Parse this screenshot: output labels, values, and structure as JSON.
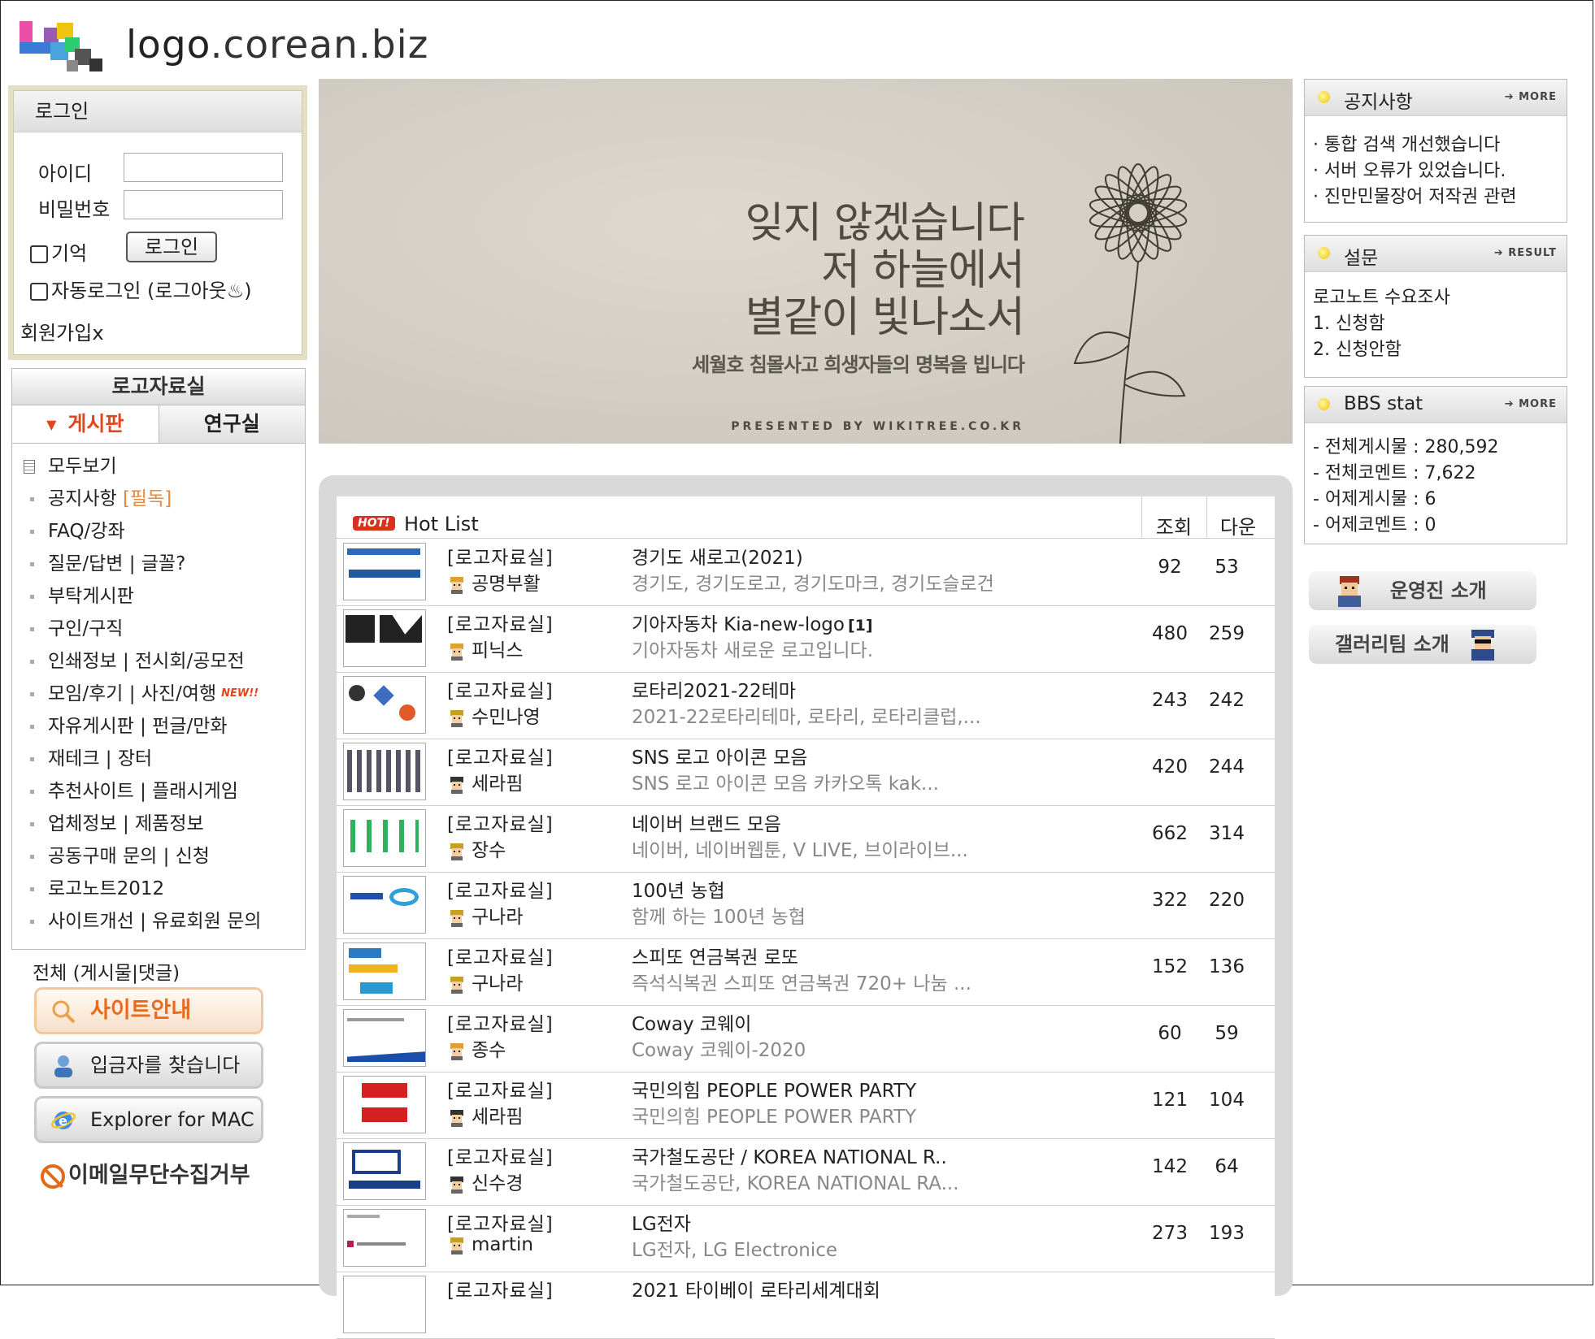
{
  "header": {
    "logo_prefix": "logo",
    "logo_suffix": ".corean.biz"
  },
  "login": {
    "title": "로그인",
    "id_label": "아이디",
    "pw_label": "비밀번호",
    "id_value": "",
    "pw_value": "",
    "remember_label": "기억",
    "button_label": "로그인",
    "auto_login_label": "자동로그인 (로그아웃♨)",
    "signup_label": "회원가입x"
  },
  "board": {
    "title": "로고자료실",
    "tabs": [
      {
        "label": "게시판"
      },
      {
        "label": "연구실"
      }
    ],
    "items": [
      {
        "label": "모두보기"
      },
      {
        "label": "공지사항",
        "tag": "[필독]"
      },
      {
        "label": "FAQ/강좌"
      },
      {
        "label": "질문/답변 | 글꼴?"
      },
      {
        "label": "부탁게시판"
      },
      {
        "label": "구인/구직"
      },
      {
        "label": "인쇄정보 | 전시회/공모전"
      },
      {
        "label": "모임/후기 | 사진/여행",
        "badge": "NEW!!"
      },
      {
        "label": "자유게시판 | 펀글/만화"
      },
      {
        "label": "재테크 | 장터"
      },
      {
        "label": "추천사이트 | 플래시게임"
      },
      {
        "label": "업체정보 | 제품정보"
      },
      {
        "label": "공동구매 문의 | 신청"
      },
      {
        "label": "로고노트2012"
      },
      {
        "label": "사이트개선 | 유료회원 문의"
      }
    ]
  },
  "sidebar_extra": {
    "total_label": "전체 (게시물|댓글)",
    "buttons": [
      {
        "label": "사이트안내",
        "icon": "magnifier-icon"
      },
      {
        "label": "입금자를 찾습니다",
        "icon": "person-icon"
      },
      {
        "label": "Explorer for MAC",
        "icon": "explorer-icon"
      }
    ],
    "no_email_label": "이메일무단수집거부"
  },
  "banner": {
    "line1": "잊지 않겠습니다",
    "line2": "저 하늘에서",
    "line3": "별같이 빛나소서",
    "sub": "세월호 침몰사고 희생자들의 명복을 빕니다",
    "credit": "PRESENTED BY WIKITREE.CO.KR"
  },
  "hot_list": {
    "badge": "HOT!",
    "title": "Hot List",
    "col_views": "조회",
    "col_downloads": "다운",
    "rows": [
      {
        "category": "[로고자료실]",
        "author": "공명부활",
        "title": "경기도 새로고(2021)",
        "comments": "",
        "desc": "경기도, 경기도로고, 경기도마크, 경기도슬로건",
        "views": "92",
        "downloads": "53"
      },
      {
        "category": "[로고자료실]",
        "author": "피닉스",
        "title": "기아자동차 Kia-new-logo",
        "comments": "[1]",
        "desc": "기아자동차 새로운 로고입니다.",
        "views": "480",
        "downloads": "259"
      },
      {
        "category": "[로고자료실]",
        "author": "수민나영",
        "title": "로타리2021-22테마",
        "comments": "",
        "desc": "2021-22로타리테마, 로타리, 로타리클럽,...",
        "views": "243",
        "downloads": "242"
      },
      {
        "category": "[로고자료실]",
        "author": "세라핌",
        "title": "SNS 로고 아이콘 모음",
        "comments": "",
        "desc": "SNS 로고 아이콘 모음 카카오톡 kak...",
        "views": "420",
        "downloads": "244"
      },
      {
        "category": "[로고자료실]",
        "author": "장수",
        "title": "네이버 브랜드 모음",
        "comments": "",
        "desc": "네이버, 네이버웹툰, V LIVE, 브이라이브...",
        "views": "662",
        "downloads": "314"
      },
      {
        "category": "[로고자료실]",
        "author": "구나라",
        "title": "100년 농협",
        "comments": "",
        "desc": "함께 하는 100년 농협",
        "views": "322",
        "downloads": "220"
      },
      {
        "category": "[로고자료실]",
        "author": "구나라",
        "title": "스피또 연금복권 로또",
        "comments": "",
        "desc": "즉석식복권 스피또 연금복권 720+ 나눔 ...",
        "views": "152",
        "downloads": "136"
      },
      {
        "category": "[로고자료실]",
        "author": "종수",
        "title": "Coway 코웨이",
        "comments": "",
        "desc": "Coway 코웨이-2020",
        "views": "60",
        "downloads": "59"
      },
      {
        "category": "[로고자료실]",
        "author": "세라핌",
        "title": "국민의힘 PEOPLE POWER PARTY",
        "comments": "",
        "desc": "국민의힘 PEOPLE POWER PARTY",
        "views": "121",
        "downloads": "104"
      },
      {
        "category": "[로고자료실]",
        "author": "신수경",
        "title": "국가철도공단 / KOREA NATIONAL R..",
        "comments": "",
        "desc": "국가철도공단, KOREA NATIONAL RA...",
        "views": "142",
        "downloads": "64"
      },
      {
        "category": "[로고자료실]",
        "author": "martin",
        "title": "LG전자",
        "comments": "",
        "desc": "LG전자, LG Electronice",
        "views": "273",
        "downloads": "193"
      },
      {
        "category": "[로고자료실]",
        "author": "",
        "title": "2021 타이베이 로타리세계대회",
        "comments": "",
        "desc": "",
        "views": "",
        "downloads": ""
      }
    ]
  },
  "notice": {
    "title": "공지사항",
    "more": "MORE",
    "items": [
      "· 통합 검색 개선했습니다",
      "· 서버 오류가 있었습니다.",
      "· 진만민물장어 저작권 관련"
    ]
  },
  "poll": {
    "title": "설문",
    "more": "RESULT",
    "question": "로고노트 수요조사",
    "options": [
      "1. 신청함",
      "2. 신청안함"
    ]
  },
  "stats": {
    "title": "BBS stat",
    "more": "MORE",
    "lines": [
      "- 전체게시물 : 280,592",
      "- 전체코멘트 : 7,622",
      "- 어제게시물 : 6",
      "- 어제코멘트 : 0"
    ]
  },
  "staff": {
    "staff_label": "운영진 소개",
    "gallery_label": "갤러리팀 소개"
  },
  "colors": {
    "accent": "#e2461d",
    "hot": "#d8321e",
    "guide": "#ea6a1a",
    "login_frame": "#e4dfc4"
  }
}
